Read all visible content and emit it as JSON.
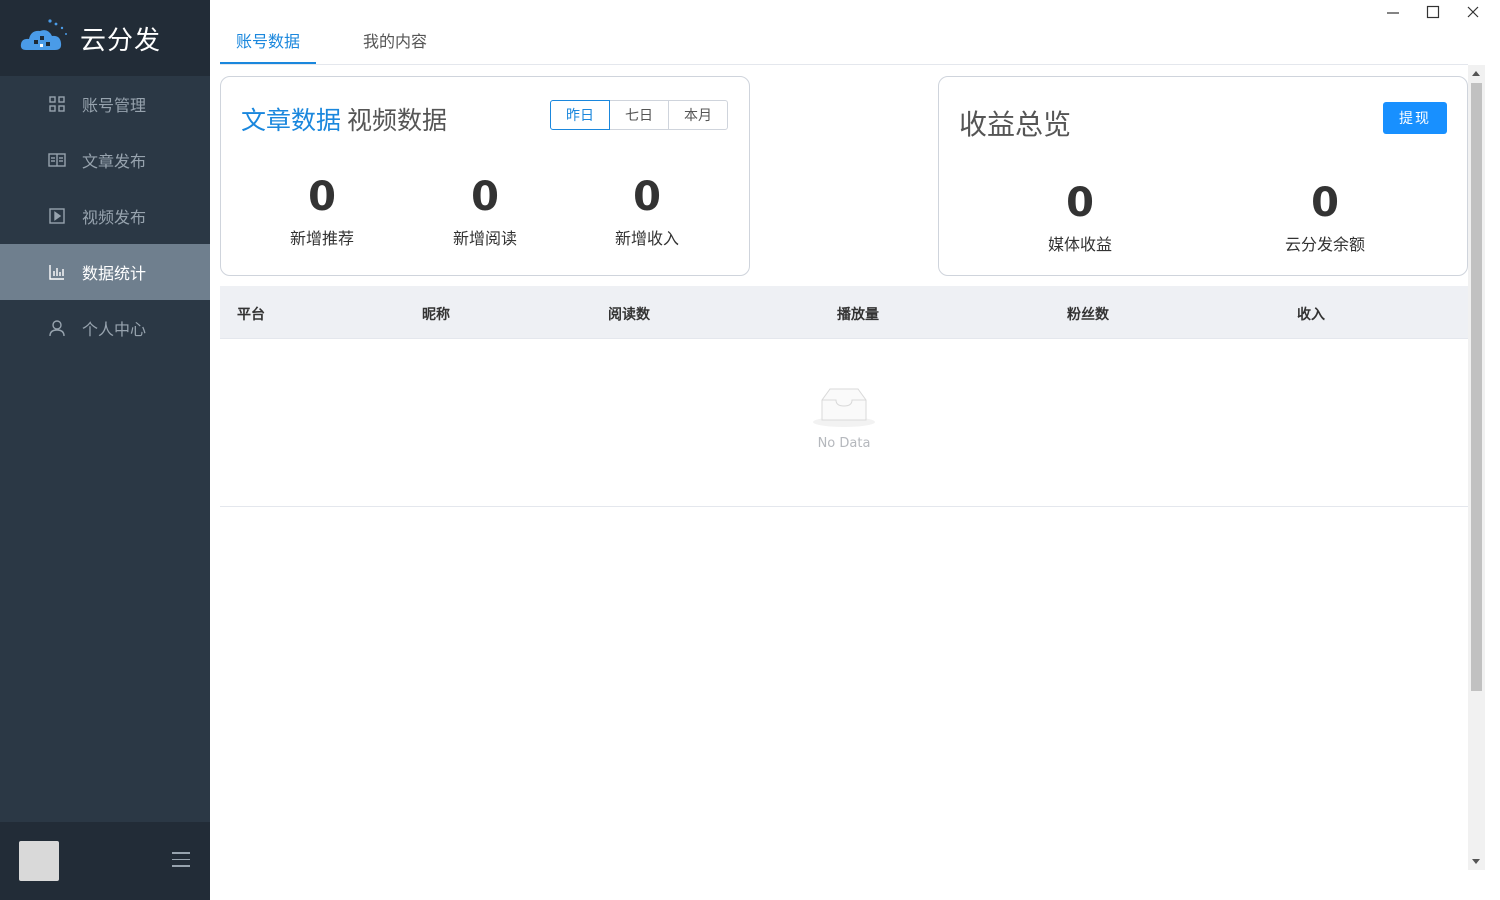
{
  "app": {
    "title": "云分发"
  },
  "sidebar": {
    "items": [
      {
        "label": "账号管理",
        "icon": "grid-icon",
        "active": false
      },
      {
        "label": "文章发布",
        "icon": "book-icon",
        "active": false
      },
      {
        "label": "视频发布",
        "icon": "play-icon",
        "active": false
      },
      {
        "label": "数据统计",
        "icon": "bar-chart-icon",
        "active": true
      },
      {
        "label": "个人中心",
        "icon": "user-icon",
        "active": false
      }
    ]
  },
  "tabs": [
    {
      "label": "账号数据",
      "active": true
    },
    {
      "label": "我的内容",
      "active": false
    }
  ],
  "content_card": {
    "tabs": [
      {
        "label": "文章数据",
        "active": true
      },
      {
        "label": "视频数据",
        "active": false
      }
    ],
    "periods": [
      {
        "label": "昨日",
        "active": true
      },
      {
        "label": "七日",
        "active": false
      },
      {
        "label": "本月",
        "active": false
      }
    ],
    "stats": [
      {
        "value": "0",
        "label": "新增推荐"
      },
      {
        "value": "0",
        "label": "新增阅读"
      },
      {
        "value": "0",
        "label": "新增收入"
      }
    ]
  },
  "revenue_card": {
    "title": "收益总览",
    "withdraw_label": "提现",
    "stats": [
      {
        "value": "0",
        "label": "媒体收益"
      },
      {
        "value": "0",
        "label": "云分发余额"
      }
    ]
  },
  "table": {
    "columns": [
      "平台",
      "昵称",
      "阅读数",
      "播放量",
      "粉丝数",
      "收入"
    ],
    "rows": [],
    "empty_text": "No Data"
  },
  "colors": {
    "sidebar_bg": "#2b3845",
    "sidebar_active": "#6f7f8e",
    "accent": "#1a87dd",
    "button": "#1890ff"
  }
}
